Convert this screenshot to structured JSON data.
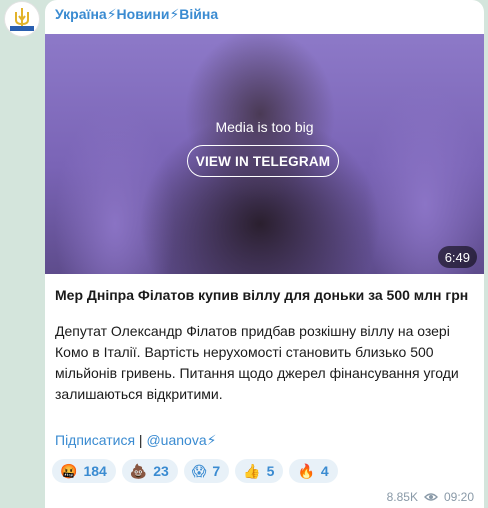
{
  "channel": {
    "title": "Україна⚡Новини⚡Війна",
    "avatar_text": "УКРАЇНА"
  },
  "media": {
    "message": "Media is too big",
    "button_label": "VIEW IN TELEGRAM",
    "duration": "6:49"
  },
  "post": {
    "headline": "Мер Дніпра Філатов купив віллу для доньки за 500 млн грн",
    "body_lines": [
      "Депутат Олександр Філатов придбав розкішну віллу на озері",
      "Комо в Італії. Вартість нерухомості становить близько 500",
      "мільйонів гривень. Питання щодо джерел фінансування угоди",
      "залишаються відкритими."
    ],
    "subscribe_link": "Підписатися",
    "separator": " | ",
    "channel_link": "@uanova⚡"
  },
  "reactions": [
    {
      "emoji": "🤬",
      "count": "184"
    },
    {
      "emoji": "💩",
      "count": "23"
    },
    {
      "emoji": "😱",
      "count": "7"
    },
    {
      "emoji": "👍",
      "count": "5"
    },
    {
      "emoji": "🔥",
      "count": "4"
    }
  ],
  "meta": {
    "views": "8.85K",
    "time": "09:20"
  },
  "icons": {
    "views": "eye-icon"
  },
  "colors": {
    "link": "#3a8bd1",
    "background": "#d4e5dc"
  }
}
